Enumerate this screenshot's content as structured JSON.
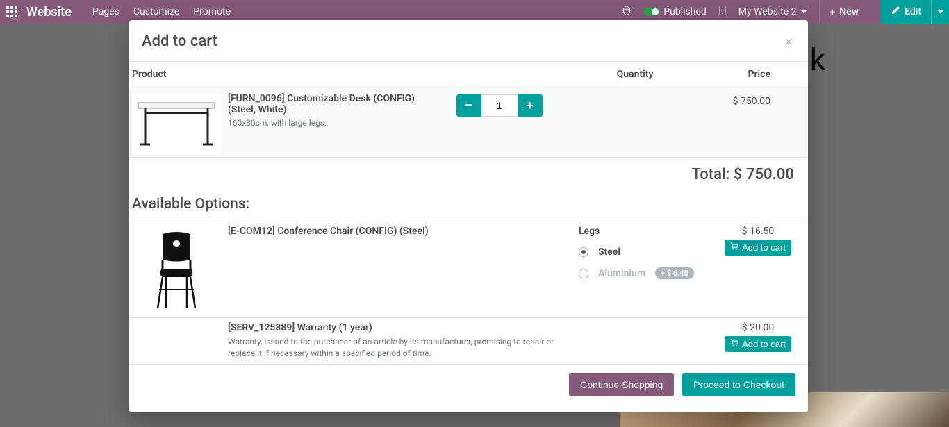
{
  "topbar": {
    "brand": "Website",
    "menu": {
      "pages": "Pages",
      "customize": "Customize",
      "promote": "Promote"
    },
    "published_label": "Published",
    "site_switcher": "My Website 2",
    "new_label": "New",
    "edit_label": "Edit"
  },
  "background": {
    "partial_heading": "k"
  },
  "modal": {
    "title": "Add to cart",
    "columns": {
      "product": "Product",
      "quantity": "Quantity",
      "price": "Price"
    },
    "main_item": {
      "name": "[FURN_0096] Customizable Desk (CONFIG) (Steel, White)",
      "desc": "160x80cm, with large legs.",
      "quantity": "1",
      "price": "$ 750.00"
    },
    "total": {
      "label": "Total:",
      "amount": "$ 750.00"
    },
    "available_options_heading": "Available Options:",
    "option1": {
      "name": "[E-COM12] Conference Chair (CONFIG) (Steel)",
      "variant_title": "Legs",
      "variants": {
        "steel": "Steel",
        "aluminium": "Aluminium",
        "aluminium_badge": "+ $ 6.40"
      },
      "price": "$ 16.50",
      "add_label": "Add to cart"
    },
    "option2": {
      "name": "[SERV_125889] Warranty (1 year)",
      "desc": "Warranty, issued to the purchaser of an article by its manufacturer, promising to repair or replace it if necessary within a specified period of time.",
      "price": "$ 20.00",
      "add_label": "Add to cart"
    },
    "footer": {
      "continue": "Continue Shopping",
      "checkout": "Proceed to Checkout"
    }
  }
}
